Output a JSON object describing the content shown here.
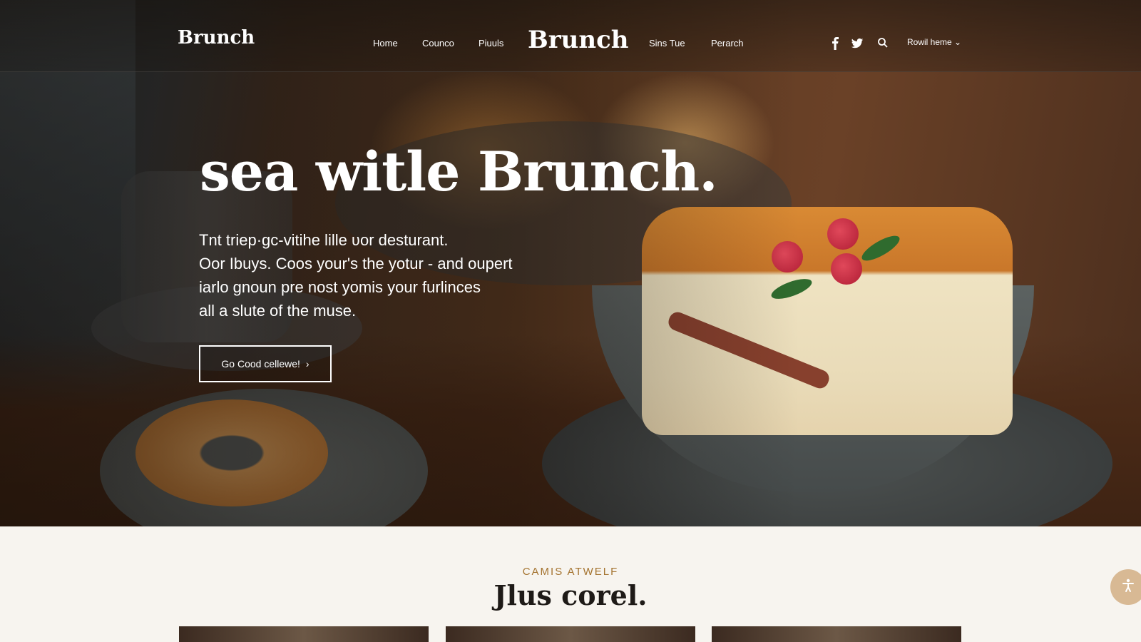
{
  "nav": {
    "brand": "Brunch",
    "center_brand": "Brunch",
    "links": [
      "Home",
      "Counco",
      "Piuuls",
      "Sins Tue",
      "Perarch"
    ],
    "social_icons": [
      "facebook-icon",
      "twitter-icon"
    ],
    "search_icon": "search-icon",
    "account_label": "Rowil heme"
  },
  "hero": {
    "headline": "sea witle Brunch.",
    "subtext_lines": [
      "Tnt triep·gc-vitihe lille ʋor desturant.",
      "Oor Ibuys. Coos your's the yotur - and oupert",
      "iarlo gnoun pre nost yomis your furlinces",
      " all a slute of the muse."
    ],
    "cta_label": "Go Cood cellewe!",
    "cta_arrow": "›"
  },
  "section": {
    "kicker": "CAMIS ATWELF",
    "title": "Jlus corel.",
    "cards": [
      "card-1",
      "card-2",
      "card-3"
    ]
  },
  "fab": {
    "icon": "accessibility-icon"
  },
  "colors": {
    "accent": "#a4732f",
    "page_bg": "#f7f4ef",
    "fab_bg": "#d8b994"
  }
}
